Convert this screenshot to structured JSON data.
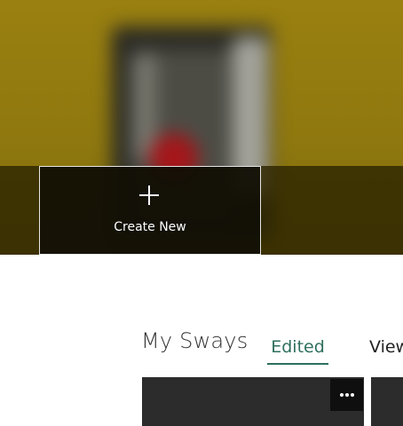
{
  "hero": {
    "create_new": {
      "label": "Create New",
      "icon": "plus-icon"
    }
  },
  "my_sways": {
    "title": "My Sways",
    "tabs": [
      {
        "label": "Edited",
        "selected": true
      },
      {
        "label": "Viewed",
        "selected": false
      }
    ],
    "card_menu_icon": "more-options-icon"
  },
  "colors": {
    "accent": "#2e6f5d",
    "card_background": "#2c2c2c",
    "hero_yellow": "#9a8010"
  }
}
